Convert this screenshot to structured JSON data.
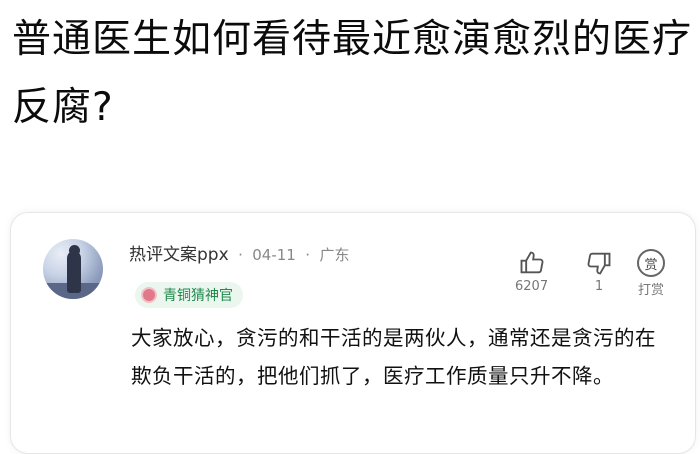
{
  "question": {
    "title": "普通医生如何看待最近愈演愈烈的医疗反腐?"
  },
  "comment": {
    "username": "热评文案ppx",
    "date": "04-11",
    "location": "广东",
    "badge_label": "青铜猜神官",
    "text": "大家放心，贪污的和干活的是两伙人，通常还是贪污的在欺负干活的，把他们抓了，医疗工作质量只升不降。",
    "likes": "6207",
    "dislikes": "1",
    "reward_label": "打赏",
    "reward_icon_text": "赏"
  },
  "icons": {
    "like": "thumbs-up-icon",
    "dislike": "thumbs-down-icon",
    "reward": "reward-icon",
    "badge": "medal-icon"
  },
  "colors": {
    "badge_bg": "#eaf6ee",
    "badge_text": "#1f8a4c"
  }
}
